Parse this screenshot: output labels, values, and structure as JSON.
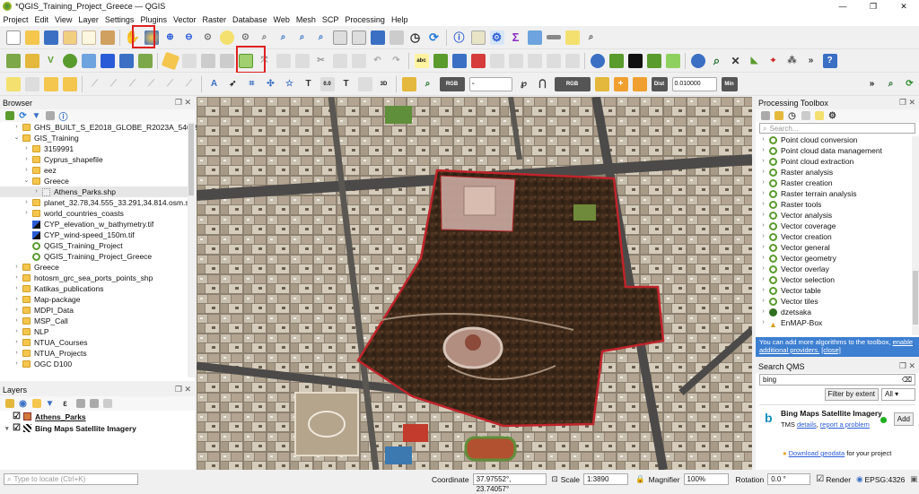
{
  "window": {
    "title": "*QGIS_Training_Project_Greece — QGIS",
    "minimize": "—",
    "restore": "❐",
    "close": "✕"
  },
  "menu": [
    "Project",
    "Edit",
    "View",
    "Layer",
    "Settings",
    "Plugins",
    "Vector",
    "Raster",
    "Database",
    "Web",
    "Mesh",
    "SCP",
    "Processing",
    "Help"
  ],
  "toolbar3": {
    "rgb_label": "RGB",
    "combo_value": "-",
    "rgb2_label": "RGB",
    "dist_label": "Dist",
    "dist_value": "0.010000",
    "min_label": "Min",
    "more": "»"
  },
  "browser": {
    "title": "Browser",
    "items": [
      {
        "label": "GHS_BUILT_S_E2018_GLOBE_R2023A_54009",
        "indent": 2,
        "icon": "folder",
        "arrow": "›"
      },
      {
        "label": "GIS_Training",
        "indent": 2,
        "icon": "folder",
        "arrow": "⌄"
      },
      {
        "label": "3159991",
        "indent": 3,
        "icon": "folder",
        "arrow": "›"
      },
      {
        "label": "Cyprus_shapefile",
        "indent": 3,
        "icon": "folder",
        "arrow": "›"
      },
      {
        "label": "eez",
        "indent": 3,
        "icon": "folder",
        "arrow": "›"
      },
      {
        "label": "Greece",
        "indent": 3,
        "icon": "folder",
        "arrow": "⌄"
      },
      {
        "label": "Athens_Parks.shp",
        "indent": 4,
        "icon": "shape",
        "arrow": "›"
      },
      {
        "label": "planet_32.78,34.555_33.291,34.814.osm.s",
        "indent": 3,
        "icon": "folder",
        "arrow": "›"
      },
      {
        "label": "world_countries_coasts",
        "indent": 3,
        "icon": "folder",
        "arrow": "›"
      },
      {
        "label": "CYP_elevation_w_bathymetry.tif",
        "indent": 3,
        "icon": "raster",
        "arrow": ""
      },
      {
        "label": "CYP_wind-speed_150m.tif",
        "indent": 3,
        "icon": "raster",
        "arrow": ""
      },
      {
        "label": "QGIS_Training_Project",
        "indent": 3,
        "icon": "qgis",
        "arrow": ""
      },
      {
        "label": "QGIS_Training_Project_Greece",
        "indent": 3,
        "icon": "qgis",
        "arrow": ""
      },
      {
        "label": "Greece",
        "indent": 2,
        "icon": "folder",
        "arrow": "›"
      },
      {
        "label": "hotosm_grc_sea_ports_points_shp",
        "indent": 2,
        "icon": "folder",
        "arrow": "›"
      },
      {
        "label": "Katikas_publications",
        "indent": 2,
        "icon": "folder",
        "arrow": "›"
      },
      {
        "label": "Map-package",
        "indent": 2,
        "icon": "folder",
        "arrow": "›"
      },
      {
        "label": "MDPI_Data",
        "indent": 2,
        "icon": "folder",
        "arrow": "›"
      },
      {
        "label": "MSP_Call",
        "indent": 2,
        "icon": "folder",
        "arrow": "›"
      },
      {
        "label": "NLP",
        "indent": 2,
        "icon": "folder",
        "arrow": "›"
      },
      {
        "label": "NTUA_Courses",
        "indent": 2,
        "icon": "folder",
        "arrow": "›"
      },
      {
        "label": "NTUA_Projects",
        "indent": 2,
        "icon": "folder",
        "arrow": "›"
      },
      {
        "label": "OGC D100",
        "indent": 2,
        "icon": "folder",
        "arrow": "›"
      }
    ]
  },
  "layers": {
    "title": "Layers",
    "items": [
      {
        "label": "Athens_Parks",
        "checked": true
      },
      {
        "label": "Bing Maps Satellite Imagery",
        "checked": true
      }
    ]
  },
  "processing": {
    "title": "Processing Toolbox",
    "search_placeholder": "Search...",
    "items": [
      "Point cloud conversion",
      "Point cloud data management",
      "Point cloud extraction",
      "Raster analysis",
      "Raster creation",
      "Raster terrain analysis",
      "Raster tools",
      "Vector analysis",
      "Vector coverage",
      "Vector creation",
      "Vector general",
      "Vector geometry",
      "Vector overlay",
      "Vector selection",
      "Vector table",
      "Vector tiles",
      "dzetsaka",
      "EnMAP-Box"
    ],
    "notice_text": "You can add more algorithms to the toolbox,",
    "notice_link1": "enable additional providers.",
    "notice_link2": "[close]"
  },
  "qms": {
    "title": "Search QMS",
    "search_value": "bing",
    "filter_button": "Filter by extent",
    "all_option": "All",
    "result_title": "Bing Maps Satellite Imagery",
    "result_type": "TMS",
    "details_link": "details",
    "report_link": "report a problem",
    "add_button": "Add",
    "download_link": "Download geodata",
    "download_suffix": "for your project"
  },
  "status": {
    "locate_placeholder": "Type to locate (Ctrl+K)",
    "coordinate_label": "Coordinate",
    "coordinate_value": "37.97552°, 23.74057°",
    "scale_label": "Scale",
    "scale_value": "1:3890",
    "magnifier_label": "Magnifier",
    "magnifier_value": "100%",
    "rotation_label": "Rotation",
    "rotation_value": "0.0 °",
    "render_label": "Render",
    "crs_label": "EPSG:4326"
  },
  "colors": {
    "highlight": "#e02020",
    "park_outline": "#c0242b",
    "notice_bg": "#3d7fd1",
    "qgis_green": "#589632"
  }
}
